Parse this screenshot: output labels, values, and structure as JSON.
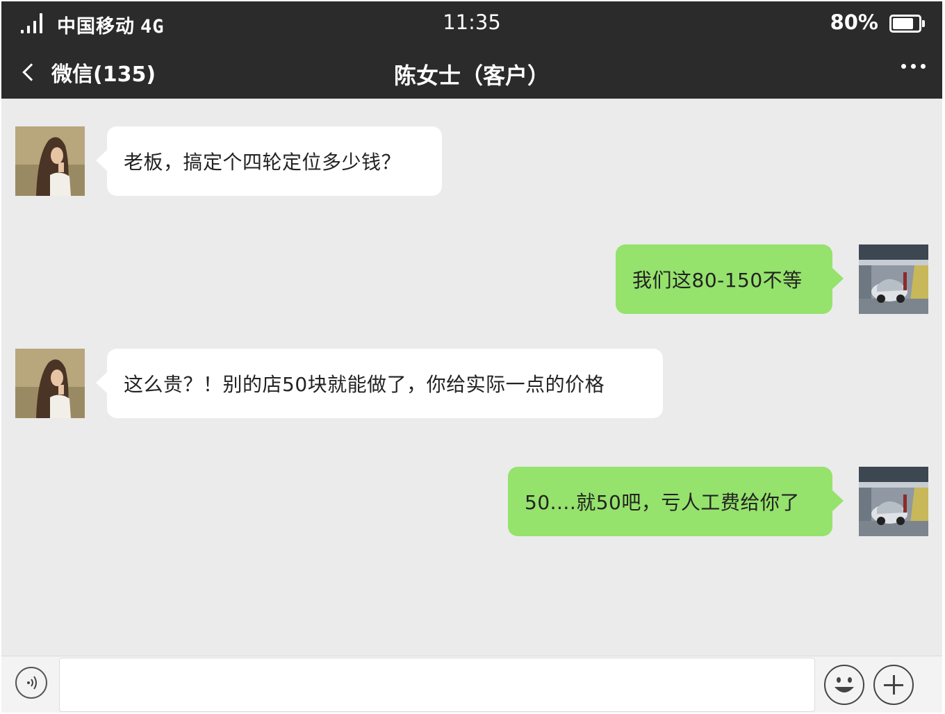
{
  "status_bar": {
    "carrier": "中国移动",
    "network": "4G",
    "time": "11:35",
    "battery_percent": "80%",
    "battery_level": 0.8
  },
  "nav": {
    "back_label": "微信(135)",
    "title": "陈女士（客户）"
  },
  "messages": [
    {
      "side": "in",
      "text": "老板，搞定个四轮定位多少钱？"
    },
    {
      "side": "out",
      "text": "我们这80-150不等"
    },
    {
      "side": "in",
      "text": "这么贵？！别的店50块就能做了，你给实际一点的价格"
    },
    {
      "side": "out",
      "text": "50....就50吧，亏人工费给你了"
    }
  ],
  "colors": {
    "header_bg": "#2b2b2b",
    "chat_bg": "#ebebeb",
    "incoming_bubble": "#ffffff",
    "outgoing_bubble": "#95e26c"
  },
  "icons": {
    "back": "chevron-left-icon",
    "more": "more-dots-icon",
    "voice": "voice-icon",
    "emoji": "emoji-icon",
    "plus": "plus-icon"
  }
}
